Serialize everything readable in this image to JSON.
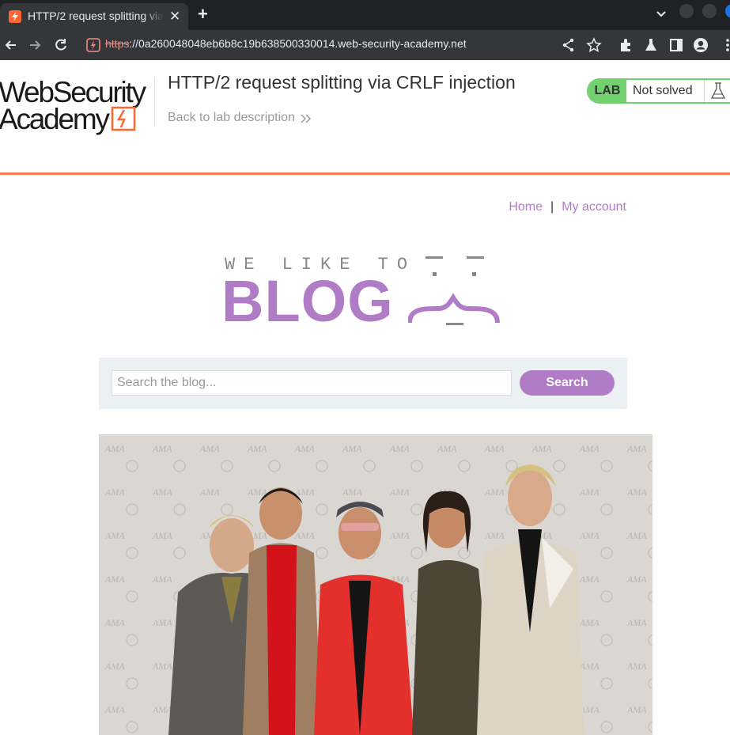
{
  "browser": {
    "tab_title": "HTTP/2 request splitting via CRLF injection",
    "url_scheme": "https",
    "url_rest": "://0a260048048eb6b8c19b638500330014.web-security-academy.net",
    "close_glyph": "✕",
    "newtab_glyph": "+"
  },
  "lab": {
    "logo_line1": "WebSecurity",
    "logo_line2": "Academy",
    "title": "HTTP/2 request splitting via CRLF injection",
    "back_link": "Back to lab description",
    "badge": "LAB",
    "status": "Not solved",
    "accent_color": "#ff6633",
    "status_color": "#70d16d"
  },
  "nav": {
    "home": "Home",
    "separator": "|",
    "account": "My account"
  },
  "banner": {
    "small": "WE LIKE TO",
    "big": "BLOG"
  },
  "search": {
    "placeholder": "Search the blog...",
    "button": "Search"
  },
  "theme": {
    "link_color": "#b07cc6"
  }
}
